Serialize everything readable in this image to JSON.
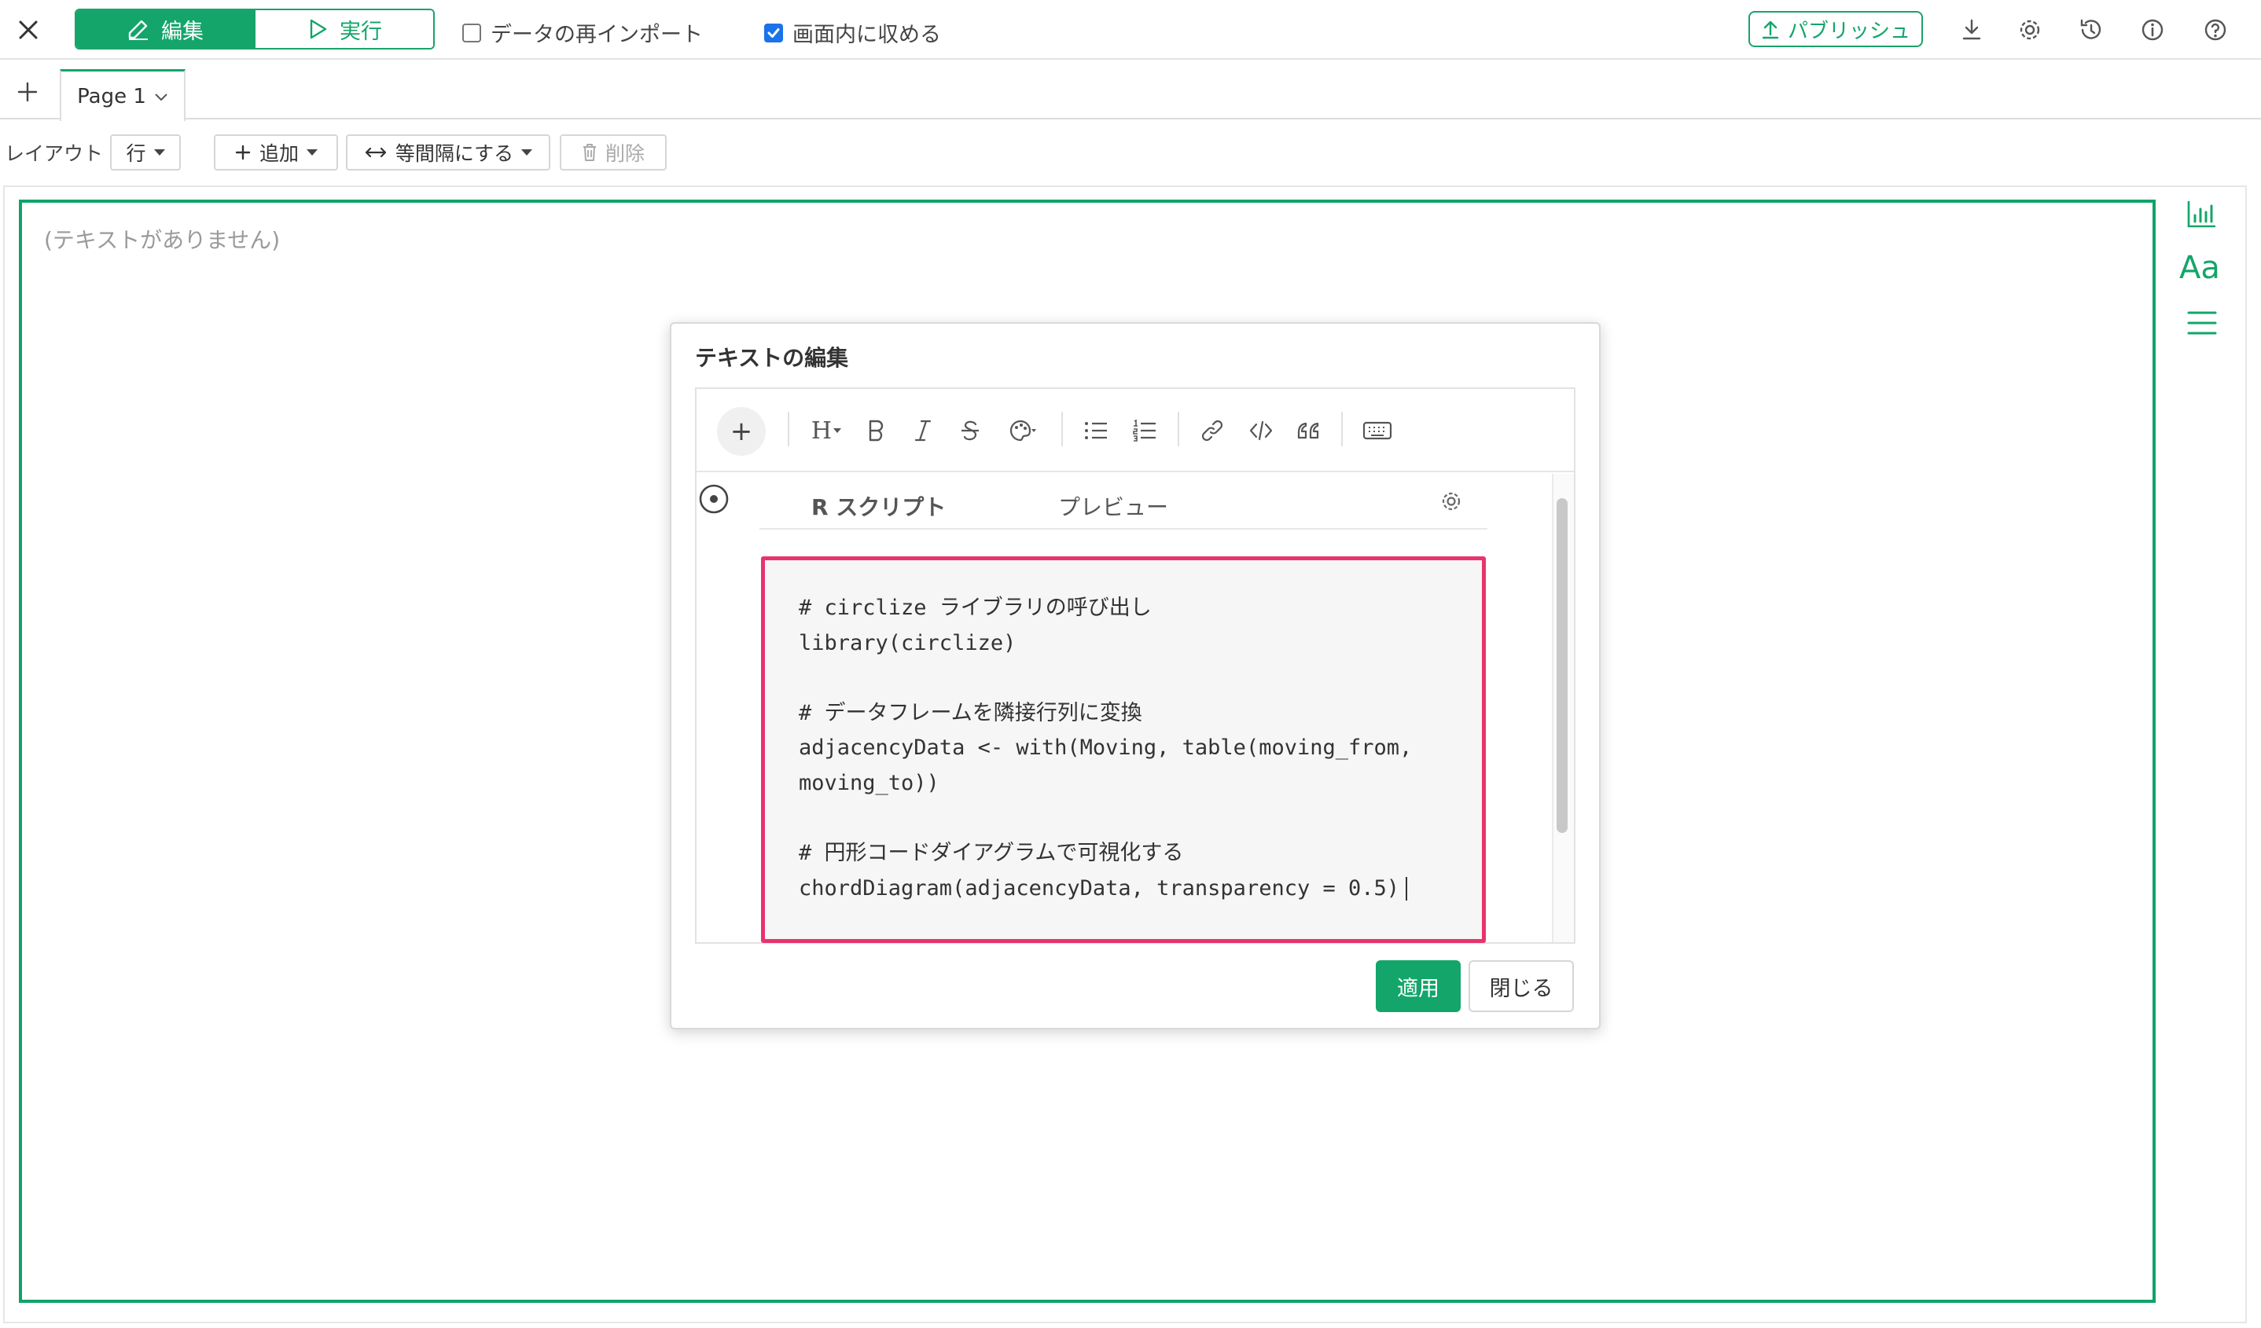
{
  "topbar": {
    "edit_label": "編集",
    "run_label": "実行",
    "reimport_label": "データの再インポート",
    "reimport_checked": false,
    "fit_label": "画面内に収める",
    "fit_checked": true,
    "publish_label": "パブリッシュ",
    "icons": [
      "close-icon",
      "edit-icon",
      "play-icon",
      "upload-icon",
      "download-icon",
      "gear-icon",
      "history-icon",
      "info-icon",
      "help-icon"
    ]
  },
  "tabs": {
    "page_label": "Page 1"
  },
  "layout_toolbar": {
    "layout_label": "レイアウト",
    "row_label": "行",
    "add_label": "追加",
    "distribute_label": "等間隔にする",
    "delete_label": "削除"
  },
  "canvas": {
    "empty_text": "(テキストがありません)"
  },
  "side_panel": {
    "font_label": "Aa"
  },
  "dialog": {
    "title": "テキストの編集",
    "editor": {
      "plus_label": "+",
      "heading_label": "H",
      "tools": [
        "heading-icon",
        "bold-icon",
        "italic-icon",
        "strikethrough-icon",
        "palette-icon",
        "bullet-list-icon",
        "numbered-list-icon",
        "link-icon",
        "code-icon",
        "quote-icon",
        "keyboard-icon"
      ]
    },
    "script_tab_label": "R スクリプト",
    "preview_tab_label": "プレビュー",
    "code_lines": [
      "# circlize ライブラリの呼び出し",
      "library(circlize)",
      "",
      "# データフレームを隣接行列に変換",
      "adjacencyData <- with(Moving, table(moving_from,",
      "moving_to))",
      "",
      "# 円形コードダイアグラムで可視化する",
      "chordDiagram(adjacencyData, transparency = 0.5)"
    ],
    "apply_label": "適用",
    "close_label": "閉じる"
  },
  "colors": {
    "brand_green": "#13a56a",
    "highlight_pink": "#e8336d",
    "checkbox_blue": "#1a73e8"
  }
}
